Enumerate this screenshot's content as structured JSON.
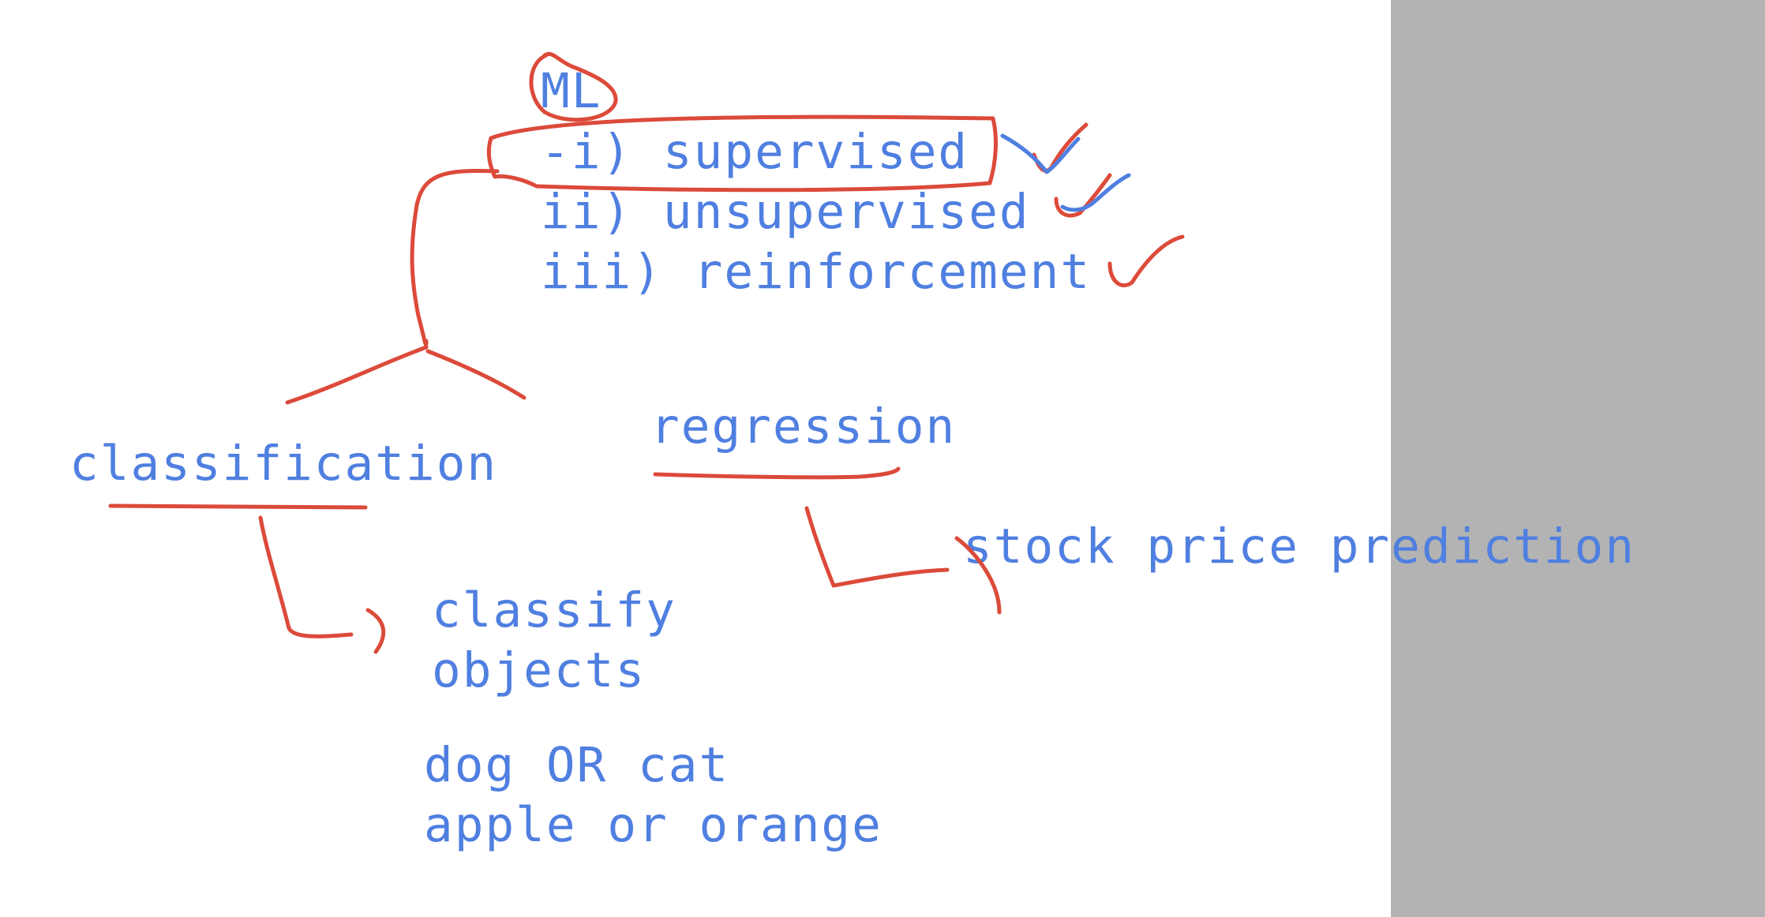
{
  "colors": {
    "background": "#ffffff",
    "side_panel": "#b3b3b3",
    "typed_text": "#4f7fe0",
    "red_ink": "#dc4a3a",
    "blue_ink": "#4f7fe0"
  },
  "typed": {
    "root": "ML",
    "types": [
      "-i) supervised",
      "ii) unsupervised",
      "iii) reinforcement"
    ],
    "branch_classification": "classification",
    "branch_regression": "regression",
    "classify_line1": "classify",
    "classify_line2": "objects",
    "regression_example": "stock price prediction",
    "example_line1": "dog OR cat",
    "example_line2": "apple or orange"
  }
}
